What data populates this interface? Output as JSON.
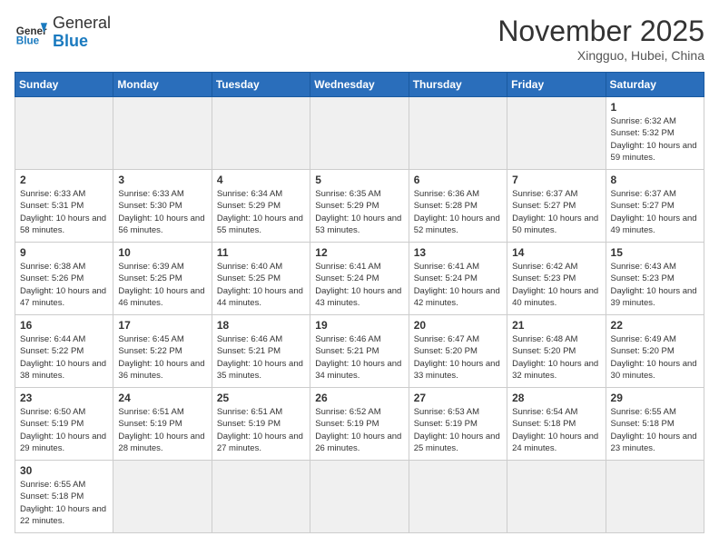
{
  "header": {
    "logo_general": "General",
    "logo_blue": "Blue",
    "month_title": "November 2025",
    "location": "Xingguo, Hubei, China"
  },
  "weekdays": [
    "Sunday",
    "Monday",
    "Tuesday",
    "Wednesday",
    "Thursday",
    "Friday",
    "Saturday"
  ],
  "days": [
    {
      "date": "",
      "info": ""
    },
    {
      "date": "",
      "info": ""
    },
    {
      "date": "",
      "info": ""
    },
    {
      "date": "",
      "info": ""
    },
    {
      "date": "",
      "info": ""
    },
    {
      "date": "",
      "info": ""
    },
    {
      "date": "1",
      "info": "Sunrise: 6:32 AM\nSunset: 5:32 PM\nDaylight: 10 hours and 59 minutes."
    },
    {
      "date": "2",
      "info": "Sunrise: 6:33 AM\nSunset: 5:31 PM\nDaylight: 10 hours and 58 minutes."
    },
    {
      "date": "3",
      "info": "Sunrise: 6:33 AM\nSunset: 5:30 PM\nDaylight: 10 hours and 56 minutes."
    },
    {
      "date": "4",
      "info": "Sunrise: 6:34 AM\nSunset: 5:29 PM\nDaylight: 10 hours and 55 minutes."
    },
    {
      "date": "5",
      "info": "Sunrise: 6:35 AM\nSunset: 5:29 PM\nDaylight: 10 hours and 53 minutes."
    },
    {
      "date": "6",
      "info": "Sunrise: 6:36 AM\nSunset: 5:28 PM\nDaylight: 10 hours and 52 minutes."
    },
    {
      "date": "7",
      "info": "Sunrise: 6:37 AM\nSunset: 5:27 PM\nDaylight: 10 hours and 50 minutes."
    },
    {
      "date": "8",
      "info": "Sunrise: 6:37 AM\nSunset: 5:27 PM\nDaylight: 10 hours and 49 minutes."
    },
    {
      "date": "9",
      "info": "Sunrise: 6:38 AM\nSunset: 5:26 PM\nDaylight: 10 hours and 47 minutes."
    },
    {
      "date": "10",
      "info": "Sunrise: 6:39 AM\nSunset: 5:25 PM\nDaylight: 10 hours and 46 minutes."
    },
    {
      "date": "11",
      "info": "Sunrise: 6:40 AM\nSunset: 5:25 PM\nDaylight: 10 hours and 44 minutes."
    },
    {
      "date": "12",
      "info": "Sunrise: 6:41 AM\nSunset: 5:24 PM\nDaylight: 10 hours and 43 minutes."
    },
    {
      "date": "13",
      "info": "Sunrise: 6:41 AM\nSunset: 5:24 PM\nDaylight: 10 hours and 42 minutes."
    },
    {
      "date": "14",
      "info": "Sunrise: 6:42 AM\nSunset: 5:23 PM\nDaylight: 10 hours and 40 minutes."
    },
    {
      "date": "15",
      "info": "Sunrise: 6:43 AM\nSunset: 5:23 PM\nDaylight: 10 hours and 39 minutes."
    },
    {
      "date": "16",
      "info": "Sunrise: 6:44 AM\nSunset: 5:22 PM\nDaylight: 10 hours and 38 minutes."
    },
    {
      "date": "17",
      "info": "Sunrise: 6:45 AM\nSunset: 5:22 PM\nDaylight: 10 hours and 36 minutes."
    },
    {
      "date": "18",
      "info": "Sunrise: 6:46 AM\nSunset: 5:21 PM\nDaylight: 10 hours and 35 minutes."
    },
    {
      "date": "19",
      "info": "Sunrise: 6:46 AM\nSunset: 5:21 PM\nDaylight: 10 hours and 34 minutes."
    },
    {
      "date": "20",
      "info": "Sunrise: 6:47 AM\nSunset: 5:20 PM\nDaylight: 10 hours and 33 minutes."
    },
    {
      "date": "21",
      "info": "Sunrise: 6:48 AM\nSunset: 5:20 PM\nDaylight: 10 hours and 32 minutes."
    },
    {
      "date": "22",
      "info": "Sunrise: 6:49 AM\nSunset: 5:20 PM\nDaylight: 10 hours and 30 minutes."
    },
    {
      "date": "23",
      "info": "Sunrise: 6:50 AM\nSunset: 5:19 PM\nDaylight: 10 hours and 29 minutes."
    },
    {
      "date": "24",
      "info": "Sunrise: 6:51 AM\nSunset: 5:19 PM\nDaylight: 10 hours and 28 minutes."
    },
    {
      "date": "25",
      "info": "Sunrise: 6:51 AM\nSunset: 5:19 PM\nDaylight: 10 hours and 27 minutes."
    },
    {
      "date": "26",
      "info": "Sunrise: 6:52 AM\nSunset: 5:19 PM\nDaylight: 10 hours and 26 minutes."
    },
    {
      "date": "27",
      "info": "Sunrise: 6:53 AM\nSunset: 5:19 PM\nDaylight: 10 hours and 25 minutes."
    },
    {
      "date": "28",
      "info": "Sunrise: 6:54 AM\nSunset: 5:18 PM\nDaylight: 10 hours and 24 minutes."
    },
    {
      "date": "29",
      "info": "Sunrise: 6:55 AM\nSunset: 5:18 PM\nDaylight: 10 hours and 23 minutes."
    },
    {
      "date": "30",
      "info": "Sunrise: 6:55 AM\nSunset: 5:18 PM\nDaylight: 10 hours and 22 minutes."
    },
    {
      "date": "",
      "info": ""
    },
    {
      "date": "",
      "info": ""
    },
    {
      "date": "",
      "info": ""
    },
    {
      "date": "",
      "info": ""
    },
    {
      "date": "",
      "info": ""
    },
    {
      "date": "",
      "info": ""
    }
  ]
}
